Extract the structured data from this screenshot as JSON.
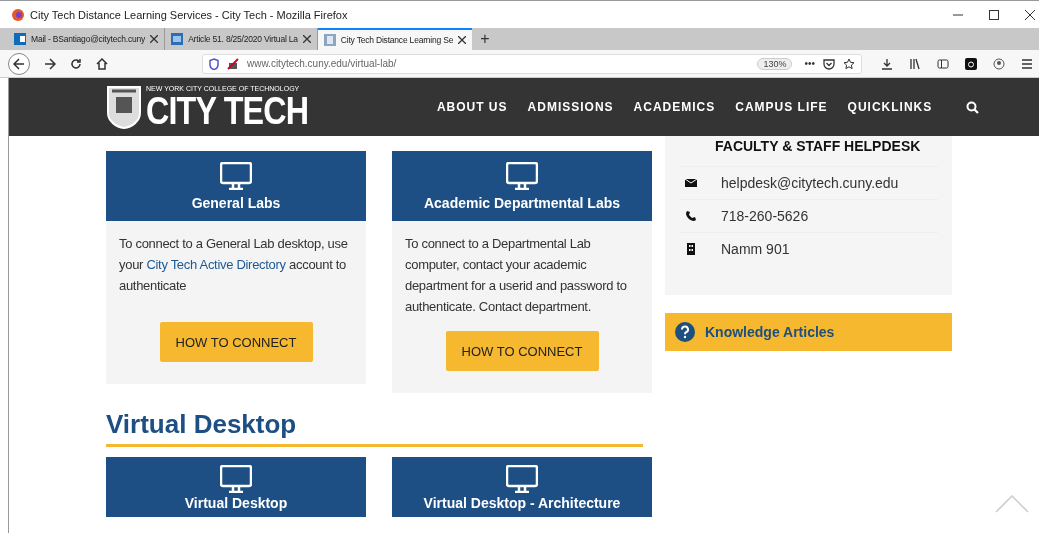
{
  "window": {
    "title": "City Tech Distance Learning Services - City Tech - Mozilla Firefox"
  },
  "tabs": [
    {
      "label": "Mail - BSantiago@citytech.cuny",
      "selected": false
    },
    {
      "label": "Article 51. 8/25/2020 Virtual La",
      "selected": false
    },
    {
      "label": "City Tech Distance Learning Se",
      "selected": true
    }
  ],
  "new_tab": "+",
  "address_bar": {
    "url": "www.citytech.cuny.edu/virtual-lab/",
    "zoom": "130%",
    "more": "•••"
  },
  "site_header": {
    "logo_subtitle": "NEW YORK CITY COLLEGE OF TECHNOLOGY",
    "logo_title": "CITY TECH",
    "nav": [
      "ABOUT US",
      "ADMISSIONS",
      "ACADEMICS",
      "CAMPUS LIFE",
      "QUICKLINKS"
    ]
  },
  "lab_cards": [
    {
      "title": "General Labs",
      "text_before": "To connect to a General Lab desktop, use your ",
      "link": "City Tech Active Directory",
      "text_after": " account to authenticate",
      "button": "HOW TO CONNECT"
    },
    {
      "title": "Academic Departmental Labs",
      "text_before": "To connect to a Departmental Lab computer, contact your academic department for a userid and password to authenticate. Contact department.",
      "button": "HOW TO CONNECT"
    }
  ],
  "helpdesk": {
    "heading": "FACULTY & STAFF HELPDESK",
    "items": [
      {
        "kind": "email",
        "text": "helpdesk@citytech.cuny.edu"
      },
      {
        "kind": "phone",
        "text": "718-260-5626"
      },
      {
        "kind": "building",
        "text": "Namm 901"
      }
    ]
  },
  "knowledge": {
    "label": "Knowledge Articles"
  },
  "section": {
    "heading": "Virtual Desktop",
    "cards": [
      {
        "title": "Virtual Desktop"
      },
      {
        "title": "Virtual Desktop - Architecture"
      }
    ]
  }
}
